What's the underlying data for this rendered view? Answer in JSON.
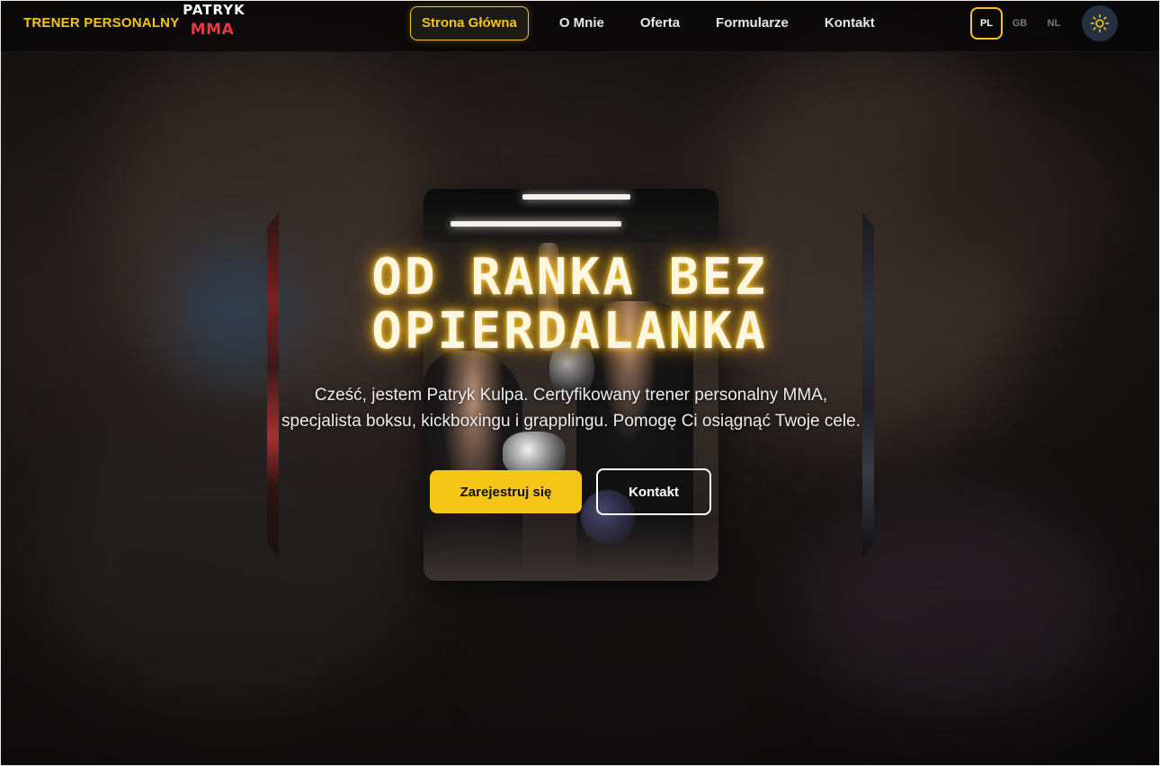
{
  "header": {
    "brand_text": "TRENER PERSONALNY",
    "logo": {
      "top": "PATRYK",
      "bottom": "MMA"
    },
    "nav": [
      {
        "label": "Strona Główna",
        "active": true
      },
      {
        "label": "O Mnie",
        "active": false
      },
      {
        "label": "Oferta",
        "active": false
      },
      {
        "label": "Formularze",
        "active": false
      },
      {
        "label": "Kontakt",
        "active": false
      }
    ],
    "languages": [
      {
        "code": "PL",
        "active": true
      },
      {
        "code": "GB",
        "active": false
      },
      {
        "code": "NL",
        "active": false
      }
    ],
    "theme_toggle_icon": "sun-icon"
  },
  "hero": {
    "title_line1": "OD RANKA BEZ",
    "title_line2": "OPIERDALANKA",
    "subtitle_line1": "Cześć, jestem Patryk Kulpa. Certyfikowany trener personalny MMA,",
    "subtitle_line2": "specjalista boksu, kickboxingu i grapplingu. Pomogę Ci osiągnąć Twoje cele.",
    "primary_button": "Zarejestruj się",
    "secondary_button": "Kontakt"
  },
  "colors": {
    "accent": "#f5c518",
    "logo_red": "#e63946",
    "theme_toggle_bg": "#243040"
  }
}
